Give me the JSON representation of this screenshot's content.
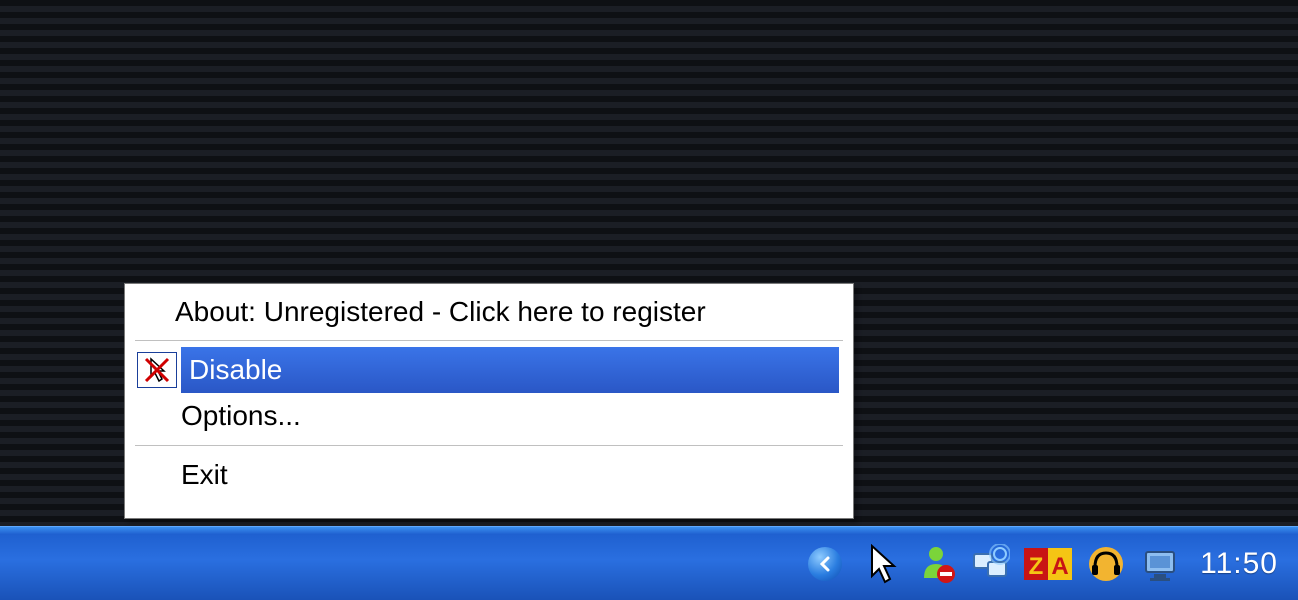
{
  "menu": {
    "about": "About: Unregistered - Click here to register",
    "disable": "Disable",
    "options": "Options...",
    "exit": "Exit"
  },
  "taskbar": {
    "clock": "11:50",
    "icons": {
      "collapse": "collapse-arrow",
      "cursor": "cursor-arrow",
      "messenger": "messenger",
      "network": "network",
      "za": "ZA",
      "headset": "headset",
      "display": "display"
    }
  }
}
